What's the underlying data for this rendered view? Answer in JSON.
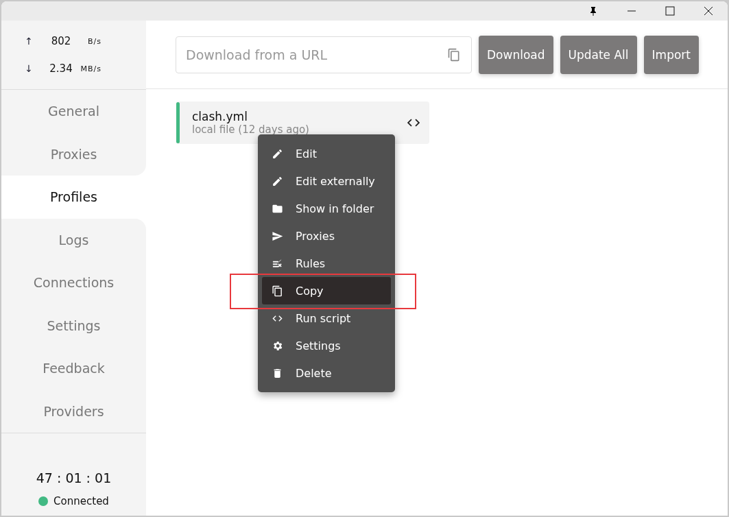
{
  "traffic": [
    {
      "arrow": "↑",
      "value": "802",
      "unit": "B/s"
    },
    {
      "arrow": "↓",
      "value": "2.34",
      "unit": "MB/s"
    }
  ],
  "sidebar": {
    "items": [
      {
        "label": "General",
        "selected": false
      },
      {
        "label": "Proxies",
        "selected": false
      },
      {
        "label": "Profiles",
        "selected": true
      },
      {
        "label": "Logs",
        "selected": false
      },
      {
        "label": "Connections",
        "selected": false
      },
      {
        "label": "Settings",
        "selected": false
      },
      {
        "label": "Feedback",
        "selected": false
      },
      {
        "label": "Providers",
        "selected": false
      }
    ]
  },
  "status": {
    "uptime": "47 : 01 : 01",
    "state": "Connected",
    "color": "#42b983"
  },
  "toolbar": {
    "url_field": {
      "placeholder": "Download from a URL"
    },
    "buttons": [
      "Download",
      "Update All",
      "Import"
    ]
  },
  "profiles": [
    {
      "name": "clash.yml",
      "subtitle": "local file (12 days ago)",
      "color": "#42b983"
    }
  ],
  "context_menu": {
    "items": [
      {
        "label": "Edit",
        "selected": false
      },
      {
        "label": "Edit externally",
        "selected": false
      },
      {
        "label": "Show in folder",
        "selected": false
      },
      {
        "label": "Proxies",
        "selected": false
      },
      {
        "label": "Rules",
        "selected": false
      },
      {
        "label": "Copy",
        "selected": true,
        "outlined": true
      },
      {
        "label": "Run script",
        "selected": false
      },
      {
        "label": "Settings",
        "selected": false
      },
      {
        "label": "Delete",
        "selected": false
      }
    ]
  }
}
